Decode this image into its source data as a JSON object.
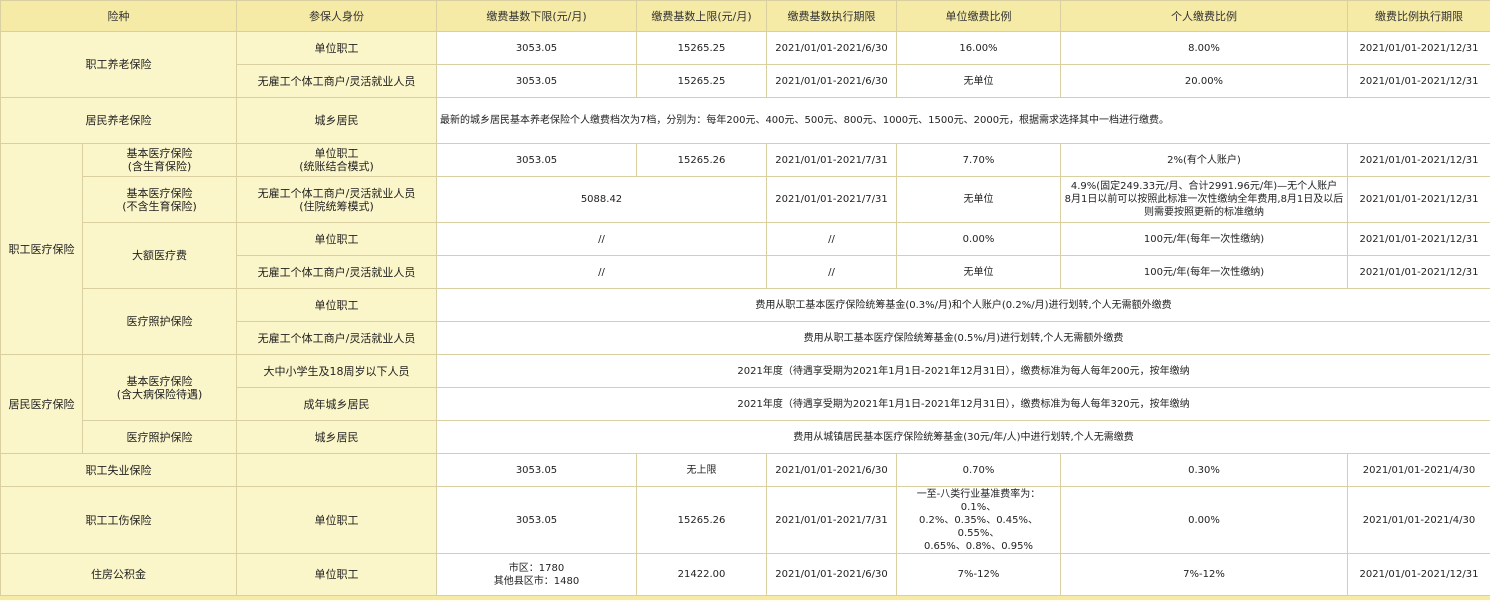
{
  "headers": [
    "险种",
    "参保人身份",
    "缴费基数下限(元/月)",
    "缴费基数上限(元/月)",
    "缴费基数执行期限",
    "单位缴费比例",
    "个人缴费比例",
    "缴费比例执行期限"
  ],
  "pension_emp": {
    "name": "职工养老保险",
    "r1": {
      "identity": "单位职工",
      "lower": "3053.05",
      "upper": "15265.25",
      "period": "2021/01/01-2021/6/30",
      "unit": "16.00%",
      "personal": "8.00%",
      "ratio_period": "2021/01/01-2021/12/31"
    },
    "r2": {
      "identity": "无雇工个体工商户/灵活就业人员",
      "lower": "3053.05",
      "upper": "15265.25",
      "period": "2021/01/01-2021/6/30",
      "unit": "无单位",
      "personal": "20.00%",
      "ratio_period": "2021/01/01-2021/12/31"
    }
  },
  "pension_res": {
    "name": "居民养老保险",
    "identity": "城乡居民",
    "note": "最新的城乡居民基本养老保险个人缴费档次为7档，分别为：每年200元、400元、500元、800元、1000元、1500元、2000元，根据需求选择其中一档进行缴费。"
  },
  "med_emp": {
    "name": "职工医疗保险",
    "basic1": {
      "name": "基本医疗保险",
      "sub": "(含生育保险)",
      "identity": "单位职工",
      "identity_sub": "(统账结合模式)",
      "lower": "3053.05",
      "upper": "15265.26",
      "period": "2021/01/01-2021/7/31",
      "unit": "7.70%",
      "personal": "2%(有个人账户)",
      "ratio_period": "2021/01/01-2021/12/31"
    },
    "basic2": {
      "name": "基本医疗保险",
      "sub": "(不含生育保险)",
      "identity": "无雇工个体工商户/灵活就业人员",
      "identity_sub": "(住院统筹模式)",
      "base": "5088.42",
      "period": "2021/01/01-2021/7/31",
      "unit": "无单位",
      "personal_l1": "4.9%(固定249.33元/月、合计2991.96元/年)—无个人账户",
      "personal_l2": "8月1日以前可以按照此标准一次性缴纳全年费用,8月1日及以后",
      "personal_l3": "则需要按照更新的标准缴纳",
      "ratio_period": "2021/01/01-2021/12/31"
    },
    "large": {
      "name": "大额医疗费",
      "r1": {
        "identity": "单位职工",
        "base": "//",
        "period": "//",
        "unit": "0.00%",
        "personal": "100元/年(每年一次性缴纳)",
        "ratio_period": "2021/01/01-2021/12/31"
      },
      "r2": {
        "identity": "无雇工个体工商户/灵活就业人员",
        "base": "//",
        "period": "//",
        "unit": "无单位",
        "personal": "100元/年(每年一次性缴纳)",
        "ratio_period": "2021/01/01-2021/12/31"
      }
    },
    "care": {
      "name": "医疗照护保险",
      "r1": {
        "identity": "单位职工",
        "note": "费用从职工基本医疗保险统筹基金(0.3%/月)和个人账户(0.2%/月)进行划转,个人无需额外缴费"
      },
      "r2": {
        "identity": "无雇工个体工商户/灵活就业人员",
        "note": "费用从职工基本医疗保险统筹基金(0.5%/月)进行划转,个人无需额外缴费"
      }
    }
  },
  "med_res": {
    "name": "居民医疗保险",
    "basic": {
      "name": "基本医疗保险",
      "sub": "(含大病保险待遇)",
      "r1": {
        "identity": "大中小学生及18周岁以下人员",
        "note": "2021年度（待遇享受期为2021年1月1日-2021年12月31日），缴费标准为每人每年200元，按年缴纳"
      },
      "r2": {
        "identity": "成年城乡居民",
        "note": "2021年度（待遇享受期为2021年1月1日-2021年12月31日），缴费标准为每人每年320元，按年缴纳"
      }
    },
    "care": {
      "name": "医疗照护保险",
      "identity": "城乡居民",
      "note": "费用从城镇居民基本医疗保险统筹基金(30元/年/人)中进行划转,个人无需缴费"
    }
  },
  "unemp": {
    "name": "职工失业保险",
    "identity": "",
    "lower": "3053.05",
    "upper": "无上限",
    "period": "2021/01/01-2021/6/30",
    "unit": "0.70%",
    "personal": "0.30%",
    "ratio_period": "2021/01/01-2021/4/30"
  },
  "injury": {
    "name": "职工工伤保险",
    "identity": "单位职工",
    "lower": "3053.05",
    "upper": "15265.26",
    "period": "2021/01/01-2021/7/31",
    "unit_l1": "一至-八类行业基准费率为：0.1%、",
    "unit_l2": "0.2%、0.35%、0.45%、0.55%、",
    "unit_l3": "0.65%、0.8%、0.95%",
    "personal": "0.00%",
    "ratio_period": "2021/01/01-2021/4/30"
  },
  "housing": {
    "name": "住房公积金",
    "identity": "单位职工",
    "lower_l1": "市区：1780",
    "lower_l2": "其他县区市：1480",
    "upper": "21422.00",
    "period": "2021/01/01-2021/6/30",
    "unit": "7%-12%",
    "personal": "7%-12%",
    "ratio_period": "2021/01/01-2021/12/31"
  }
}
